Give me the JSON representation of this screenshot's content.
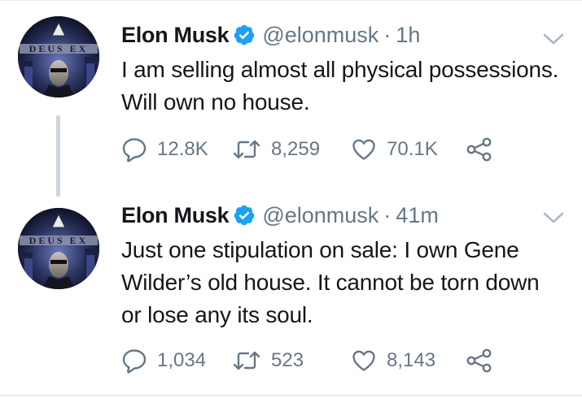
{
  "tweets": [
    {
      "author_name": "Elon Musk",
      "handle": "@elonmusk",
      "separator": "·",
      "time": "1h",
      "text": "I am selling almost all physical possessions. Will own no house.",
      "avatar_text": "DEUS EX",
      "replies": "12.8K",
      "retweets": "8,259",
      "likes": "70.1K"
    },
    {
      "author_name": "Elon Musk",
      "handle": "@elonmusk",
      "separator": "·",
      "time": "41m",
      "text": "Just one stipulation on sale: I own Gene Wilder’s old house. It cannot be torn down or lose any its soul.",
      "avatar_text": "DEUS EX",
      "replies": "1,034",
      "retweets": "523",
      "likes": "8,143"
    }
  ],
  "icons": {
    "verified": "verified-badge-icon",
    "reply": "reply-icon",
    "retweet": "retweet-icon",
    "like": "heart-icon",
    "share": "share-icon",
    "more": "chevron-down-icon"
  },
  "colors": {
    "verified_blue": "#1da1f2",
    "secondary_text": "#657786",
    "primary_text": "#14171a",
    "thread_line": "#ccd6dd",
    "divider": "#e6ecf0"
  }
}
